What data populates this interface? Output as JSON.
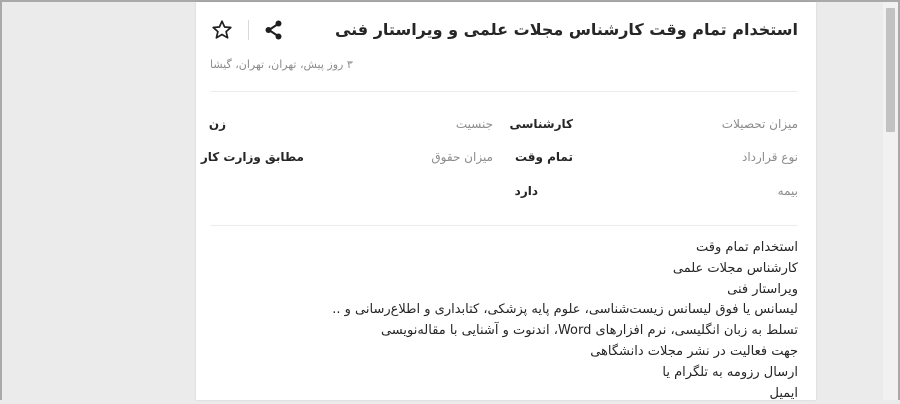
{
  "job": {
    "title": "استخدام تمام وقت کارشناس مجلات علمی و ویراستار فنی",
    "meta": "۳ روز پیش، تهران، تهران، گیشا"
  },
  "details": {
    "education_label": "میزان تحصیلات",
    "education_value": "کارشناسی",
    "gender_label": "جنسیت",
    "gender_value": "زن",
    "contract_label": "نوع قرارداد",
    "contract_value": "تمام وقت",
    "salary_label": "میزان حقوق",
    "salary_value": "مطابق وزارت کار",
    "insurance_label": "بیمه",
    "insurance_value": "دارد"
  },
  "description": {
    "lines": [
      "استخدام تمام وقت",
      "کارشناس مجلات علمی",
      "ویراستار فنی",
      "لیسانس یا فوق لیسانس زیست‌شناسی، علوم پایه پزشکی، کتابداری و اطلاع‌رسانی و ..",
      "تسلط به زبان انگلیسی، نرم افزارهای Word، اندنوت و آشنایی با مقاله‌نویسی",
      "جهت فعالیت در نشر مجلات دانشگاهی",
      "ارسال رزومه به تلگرام یا",
      "ایمیل"
    ]
  },
  "icons": {
    "share": "share-icon",
    "bookmark": "star-outline-icon"
  },
  "colors": {
    "text_primary": "#262626",
    "text_secondary": "#8c8c8c",
    "divider": "#ececec",
    "page_background": "#ebebeb"
  }
}
